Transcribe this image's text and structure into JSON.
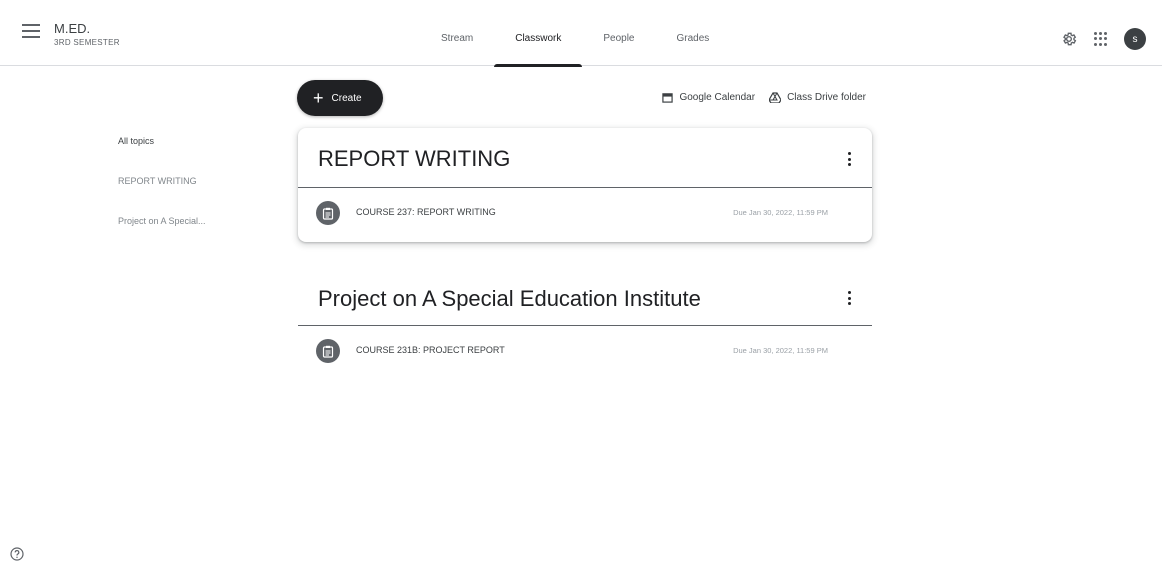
{
  "header": {
    "class_name": "M.ED.",
    "class_section": "3RD SEMESTER",
    "avatar_initial": "s"
  },
  "tabs": [
    {
      "label": "Stream"
    },
    {
      "label": "Classwork",
      "active": true
    },
    {
      "label": "People"
    },
    {
      "label": "Grades"
    }
  ],
  "toolbar": {
    "create_label": "Create",
    "calendar_label": "Google Calendar",
    "drive_label": "Class Drive folder"
  },
  "topics": [
    {
      "label": "All topics"
    },
    {
      "label": "REPORT WRITING"
    },
    {
      "label": "Project on A Special..."
    }
  ],
  "sections": [
    {
      "title": "REPORT WRITING",
      "items": [
        {
          "title": "COURSE 237: REPORT WRITING",
          "due": "Due Jan 30, 2022, 11:59 PM"
        }
      ]
    },
    {
      "title": "Project on A Special Education Institute",
      "items": [
        {
          "title": "COURSE 231B: PROJECT REPORT",
          "due": "Due Jan 30, 2022, 11:59 PM"
        }
      ]
    }
  ],
  "colors": {
    "primary_dark": "#202124",
    "text": "#3c4043",
    "muted": "#80868b",
    "divider": "#dadce0"
  }
}
